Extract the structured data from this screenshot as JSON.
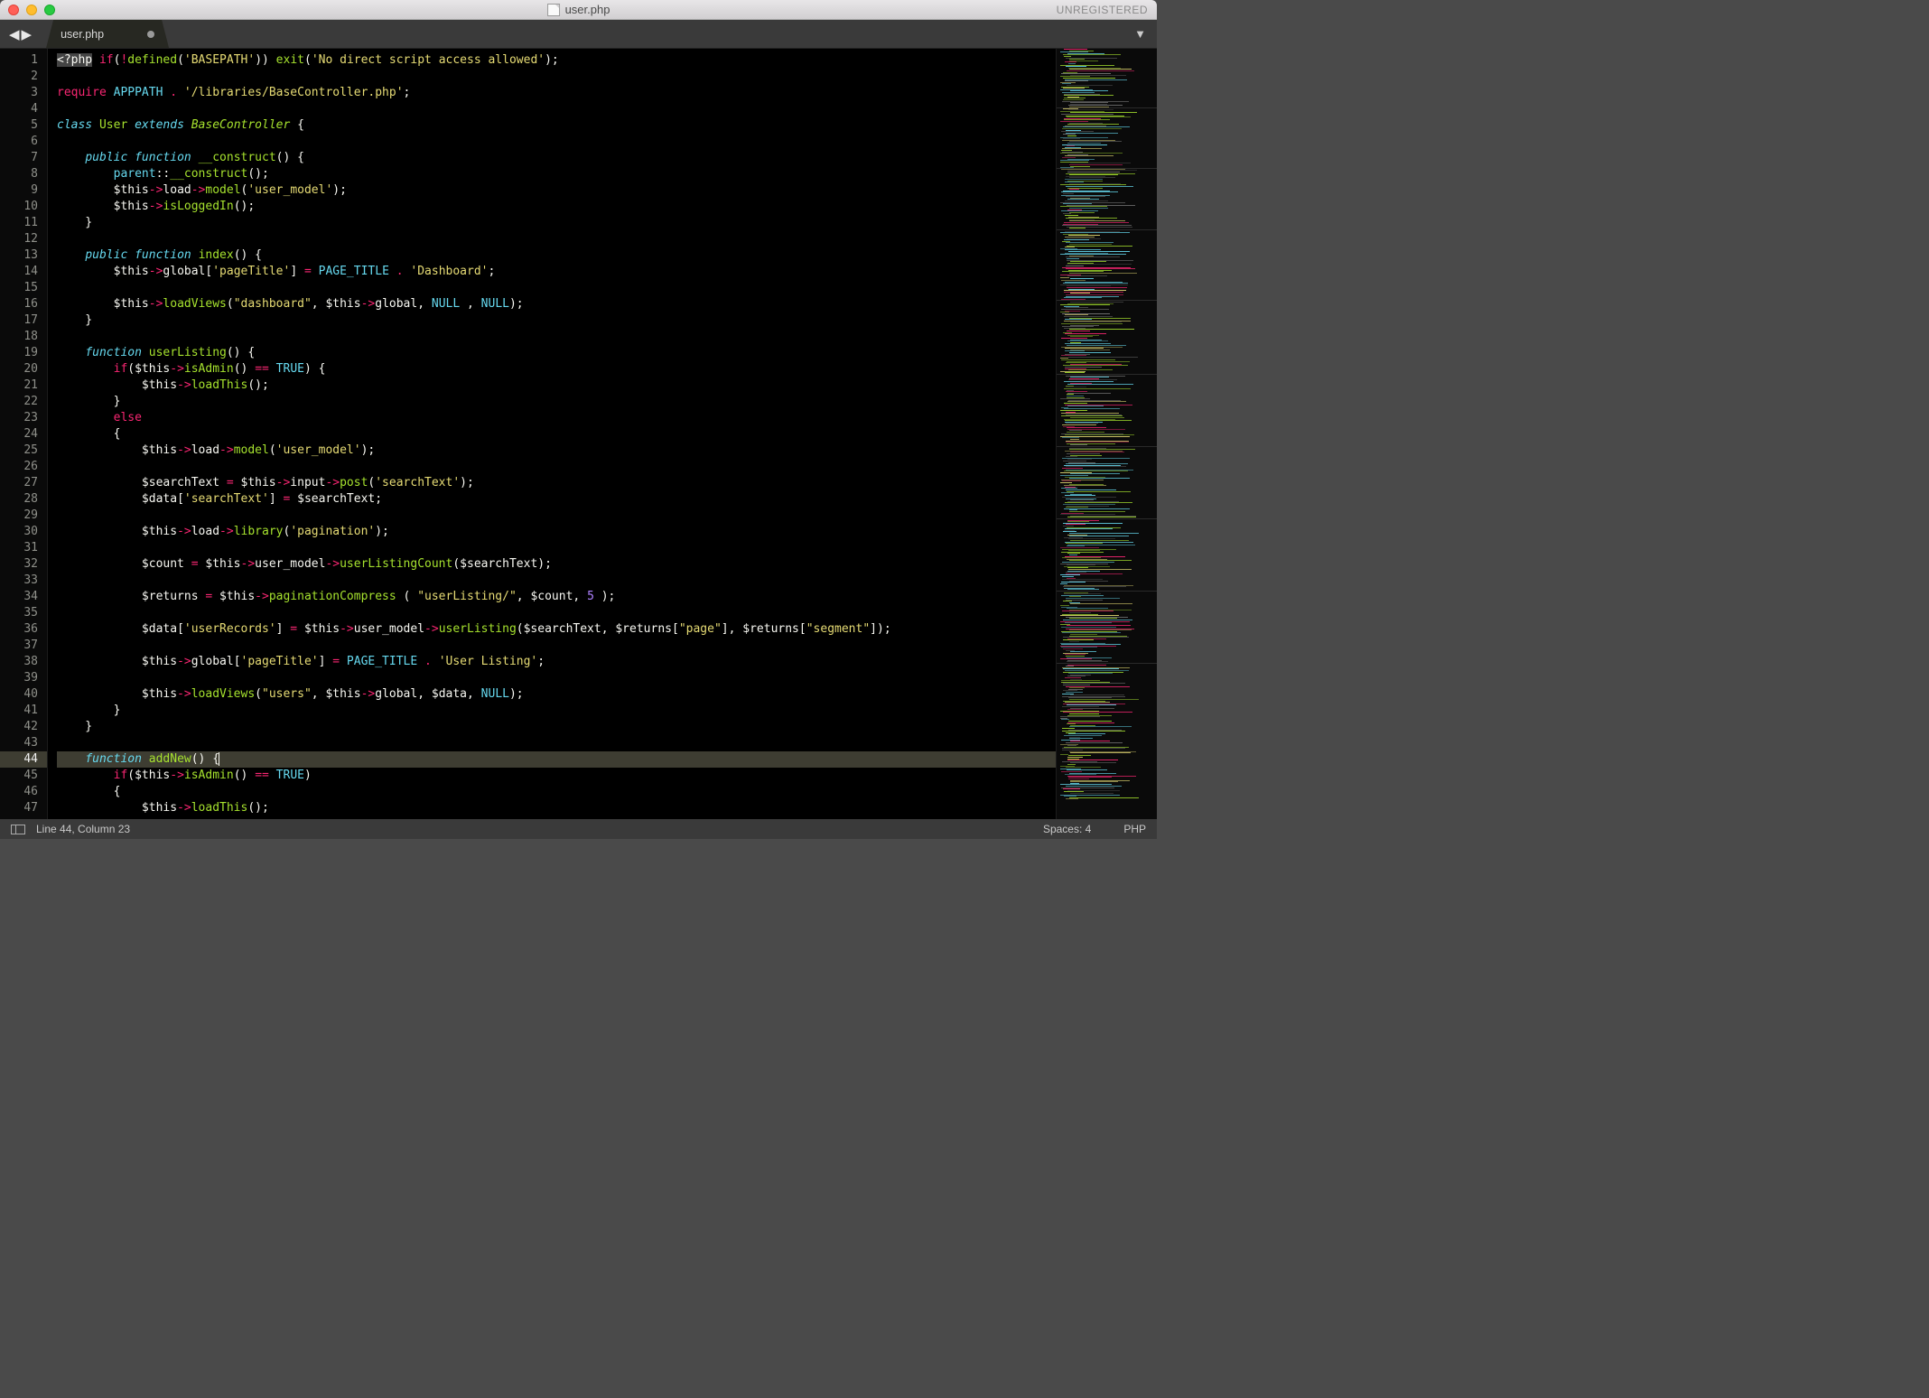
{
  "window": {
    "title": "user.php",
    "unregistered": "UNREGISTERED"
  },
  "tab": {
    "name": "user.php"
  },
  "status": {
    "position": "Line 44, Column 23",
    "spaces": "Spaces: 4",
    "lang": "PHP"
  },
  "gutter": {
    "start": 1,
    "end": 47,
    "active": 44
  },
  "code": {
    "lines": [
      [
        [
          "tag",
          "<?php"
        ],
        [
          "p",
          " "
        ],
        [
          "kw2",
          "if"
        ],
        [
          "p",
          "("
        ],
        [
          "op",
          "!"
        ],
        [
          "fn",
          "defined"
        ],
        [
          "p",
          "("
        ],
        [
          "str",
          "'BASEPATH'"
        ],
        [
          "p",
          ")) "
        ],
        [
          "fn",
          "exit"
        ],
        [
          "p",
          "("
        ],
        [
          "str",
          "'No direct script access allowed'"
        ],
        [
          "p",
          ");"
        ]
      ],
      [],
      [
        [
          "require",
          "require"
        ],
        [
          "p",
          " "
        ],
        [
          "const",
          "APPPATH"
        ],
        [
          "p",
          " "
        ],
        [
          "op",
          "."
        ],
        [
          "p",
          " "
        ],
        [
          "str",
          "'/libraries/BaseController.php'"
        ],
        [
          "p",
          ";"
        ]
      ],
      [],
      [
        [
          "kw",
          "class"
        ],
        [
          "p",
          " "
        ],
        [
          "fn",
          "User"
        ],
        [
          "p",
          " "
        ],
        [
          "kw",
          "extends"
        ],
        [
          "p",
          " "
        ],
        [
          "class",
          "BaseController"
        ],
        [
          "p",
          " {"
        ]
      ],
      [],
      [
        [
          "p",
          "    "
        ],
        [
          "kw",
          "public"
        ],
        [
          "p",
          " "
        ],
        [
          "kw",
          "function"
        ],
        [
          "p",
          " "
        ],
        [
          "fn",
          "__construct"
        ],
        [
          "p",
          "() {"
        ]
      ],
      [
        [
          "p",
          "        "
        ],
        [
          "type",
          "parent"
        ],
        [
          "p",
          "::"
        ],
        [
          "fn",
          "__construct"
        ],
        [
          "p",
          "();"
        ]
      ],
      [
        [
          "p",
          "        "
        ],
        [
          "var",
          "$this"
        ],
        [
          "op",
          "->"
        ],
        [
          "var",
          "load"
        ],
        [
          "op",
          "->"
        ],
        [
          "fn",
          "model"
        ],
        [
          "p",
          "("
        ],
        [
          "str",
          "'user_model'"
        ],
        [
          "p",
          ");"
        ]
      ],
      [
        [
          "p",
          "        "
        ],
        [
          "var",
          "$this"
        ],
        [
          "op",
          "->"
        ],
        [
          "fn",
          "isLoggedIn"
        ],
        [
          "p",
          "();"
        ]
      ],
      [
        [
          "p",
          "    }"
        ]
      ],
      [],
      [
        [
          "p",
          "    "
        ],
        [
          "kw",
          "public"
        ],
        [
          "p",
          " "
        ],
        [
          "kw",
          "function"
        ],
        [
          "p",
          " "
        ],
        [
          "fn",
          "index"
        ],
        [
          "p",
          "() {"
        ]
      ],
      [
        [
          "p",
          "        "
        ],
        [
          "var",
          "$this"
        ],
        [
          "op",
          "->"
        ],
        [
          "var",
          "global"
        ],
        [
          "p",
          "["
        ],
        [
          "str",
          "'pageTitle'"
        ],
        [
          "p",
          "] "
        ],
        [
          "op",
          "="
        ],
        [
          "p",
          " "
        ],
        [
          "const",
          "PAGE_TITLE"
        ],
        [
          "p",
          " "
        ],
        [
          "op",
          "."
        ],
        [
          "p",
          " "
        ],
        [
          "str",
          "'Dashboard'"
        ],
        [
          "p",
          ";"
        ]
      ],
      [],
      [
        [
          "p",
          "        "
        ],
        [
          "var",
          "$this"
        ],
        [
          "op",
          "->"
        ],
        [
          "fn",
          "loadViews"
        ],
        [
          "p",
          "("
        ],
        [
          "str",
          "\"dashboard\""
        ],
        [
          "p",
          ", "
        ],
        [
          "var",
          "$this"
        ],
        [
          "op",
          "->"
        ],
        [
          "var",
          "global"
        ],
        [
          "p",
          ", "
        ],
        [
          "const",
          "NULL"
        ],
        [
          "p",
          " , "
        ],
        [
          "const",
          "NULL"
        ],
        [
          "p",
          ");"
        ]
      ],
      [
        [
          "p",
          "    }"
        ]
      ],
      [],
      [
        [
          "p",
          "    "
        ],
        [
          "kw",
          "function"
        ],
        [
          "p",
          " "
        ],
        [
          "fn",
          "userListing"
        ],
        [
          "p",
          "() {"
        ]
      ],
      [
        [
          "p",
          "        "
        ],
        [
          "kw2",
          "if"
        ],
        [
          "p",
          "("
        ],
        [
          "var",
          "$this"
        ],
        [
          "op",
          "->"
        ],
        [
          "fn",
          "isAdmin"
        ],
        [
          "p",
          "() "
        ],
        [
          "op",
          "=="
        ],
        [
          "p",
          " "
        ],
        [
          "const",
          "TRUE"
        ],
        [
          "p",
          ") {"
        ]
      ],
      [
        [
          "p",
          "            "
        ],
        [
          "var",
          "$this"
        ],
        [
          "op",
          "->"
        ],
        [
          "fn",
          "loadThis"
        ],
        [
          "p",
          "();"
        ]
      ],
      [
        [
          "p",
          "        }"
        ]
      ],
      [
        [
          "p",
          "        "
        ],
        [
          "kw2",
          "else"
        ]
      ],
      [
        [
          "p",
          "        {"
        ]
      ],
      [
        [
          "p",
          "            "
        ],
        [
          "var",
          "$this"
        ],
        [
          "op",
          "->"
        ],
        [
          "var",
          "load"
        ],
        [
          "op",
          "->"
        ],
        [
          "fn",
          "model"
        ],
        [
          "p",
          "("
        ],
        [
          "str",
          "'user_model'"
        ],
        [
          "p",
          ");"
        ]
      ],
      [],
      [
        [
          "p",
          "            "
        ],
        [
          "var",
          "$searchText"
        ],
        [
          "p",
          " "
        ],
        [
          "op",
          "="
        ],
        [
          "p",
          " "
        ],
        [
          "var",
          "$this"
        ],
        [
          "op",
          "->"
        ],
        [
          "var",
          "input"
        ],
        [
          "op",
          "->"
        ],
        [
          "fn",
          "post"
        ],
        [
          "p",
          "("
        ],
        [
          "str",
          "'searchText'"
        ],
        [
          "p",
          ");"
        ]
      ],
      [
        [
          "p",
          "            "
        ],
        [
          "var",
          "$data"
        ],
        [
          "p",
          "["
        ],
        [
          "str",
          "'searchText'"
        ],
        [
          "p",
          "] "
        ],
        [
          "op",
          "="
        ],
        [
          "p",
          " "
        ],
        [
          "var",
          "$searchText"
        ],
        [
          "p",
          ";"
        ]
      ],
      [],
      [
        [
          "p",
          "            "
        ],
        [
          "var",
          "$this"
        ],
        [
          "op",
          "->"
        ],
        [
          "var",
          "load"
        ],
        [
          "op",
          "->"
        ],
        [
          "fn",
          "library"
        ],
        [
          "p",
          "("
        ],
        [
          "str",
          "'pagination'"
        ],
        [
          "p",
          ");"
        ]
      ],
      [],
      [
        [
          "p",
          "            "
        ],
        [
          "var",
          "$count"
        ],
        [
          "p",
          " "
        ],
        [
          "op",
          "="
        ],
        [
          "p",
          " "
        ],
        [
          "var",
          "$this"
        ],
        [
          "op",
          "->"
        ],
        [
          "var",
          "user_model"
        ],
        [
          "op",
          "->"
        ],
        [
          "fn",
          "userListingCount"
        ],
        [
          "p",
          "("
        ],
        [
          "var",
          "$searchText"
        ],
        [
          "p",
          ");"
        ]
      ],
      [],
      [
        [
          "p",
          "            "
        ],
        [
          "var",
          "$returns"
        ],
        [
          "p",
          " "
        ],
        [
          "op",
          "="
        ],
        [
          "p",
          " "
        ],
        [
          "var",
          "$this"
        ],
        [
          "op",
          "->"
        ],
        [
          "fn",
          "paginationCompress"
        ],
        [
          "p",
          " ( "
        ],
        [
          "str",
          "\"userListing/\""
        ],
        [
          "p",
          ", "
        ],
        [
          "var",
          "$count"
        ],
        [
          "p",
          ", "
        ],
        [
          "num",
          "5"
        ],
        [
          "p",
          " );"
        ]
      ],
      [],
      [
        [
          "p",
          "            "
        ],
        [
          "var",
          "$data"
        ],
        [
          "p",
          "["
        ],
        [
          "str",
          "'userRecords'"
        ],
        [
          "p",
          "] "
        ],
        [
          "op",
          "="
        ],
        [
          "p",
          " "
        ],
        [
          "var",
          "$this"
        ],
        [
          "op",
          "->"
        ],
        [
          "var",
          "user_model"
        ],
        [
          "op",
          "->"
        ],
        [
          "fn",
          "userListing"
        ],
        [
          "p",
          "("
        ],
        [
          "var",
          "$searchText"
        ],
        [
          "p",
          ", "
        ],
        [
          "var",
          "$returns"
        ],
        [
          "p",
          "["
        ],
        [
          "str",
          "\"page\""
        ],
        [
          "p",
          "], "
        ],
        [
          "var",
          "$returns"
        ],
        [
          "p",
          "["
        ],
        [
          "str",
          "\"segment\""
        ],
        [
          "p",
          "]);"
        ]
      ],
      [],
      [
        [
          "p",
          "            "
        ],
        [
          "var",
          "$this"
        ],
        [
          "op",
          "->"
        ],
        [
          "var",
          "global"
        ],
        [
          "p",
          "["
        ],
        [
          "str",
          "'pageTitle'"
        ],
        [
          "p",
          "] "
        ],
        [
          "op",
          "="
        ],
        [
          "p",
          " "
        ],
        [
          "const",
          "PAGE_TITLE"
        ],
        [
          "p",
          " "
        ],
        [
          "op",
          "."
        ],
        [
          "p",
          " "
        ],
        [
          "str",
          "'User Listing'"
        ],
        [
          "p",
          ";"
        ]
      ],
      [],
      [
        [
          "p",
          "            "
        ],
        [
          "var",
          "$this"
        ],
        [
          "op",
          "->"
        ],
        [
          "fn",
          "loadViews"
        ],
        [
          "p",
          "("
        ],
        [
          "str",
          "\"users\""
        ],
        [
          "p",
          ", "
        ],
        [
          "var",
          "$this"
        ],
        [
          "op",
          "->"
        ],
        [
          "var",
          "global"
        ],
        [
          "p",
          ", "
        ],
        [
          "var",
          "$data"
        ],
        [
          "p",
          ", "
        ],
        [
          "const",
          "NULL"
        ],
        [
          "p",
          ");"
        ]
      ],
      [
        [
          "p",
          "        }"
        ]
      ],
      [
        [
          "p",
          "    }"
        ]
      ],
      [],
      [
        [
          "p",
          "    "
        ],
        [
          "kw",
          "function"
        ],
        [
          "p",
          " "
        ],
        [
          "fn",
          "addNew"
        ],
        [
          "p",
          "() "
        ],
        [
          "cursor",
          "{"
        ]
      ],
      [
        [
          "p",
          "        "
        ],
        [
          "kw2",
          "if"
        ],
        [
          "p",
          "("
        ],
        [
          "var",
          "$this"
        ],
        [
          "op",
          "->"
        ],
        [
          "fn",
          "isAdmin"
        ],
        [
          "p",
          "() "
        ],
        [
          "op",
          "=="
        ],
        [
          "p",
          " "
        ],
        [
          "const",
          "TRUE"
        ],
        [
          "p",
          ")"
        ]
      ],
      [
        [
          "p",
          "        {"
        ]
      ],
      [
        [
          "p",
          "            "
        ],
        [
          "var",
          "$this"
        ],
        [
          "op",
          "->"
        ],
        [
          "fn",
          "loadThis"
        ],
        [
          "p",
          "();"
        ]
      ]
    ]
  }
}
